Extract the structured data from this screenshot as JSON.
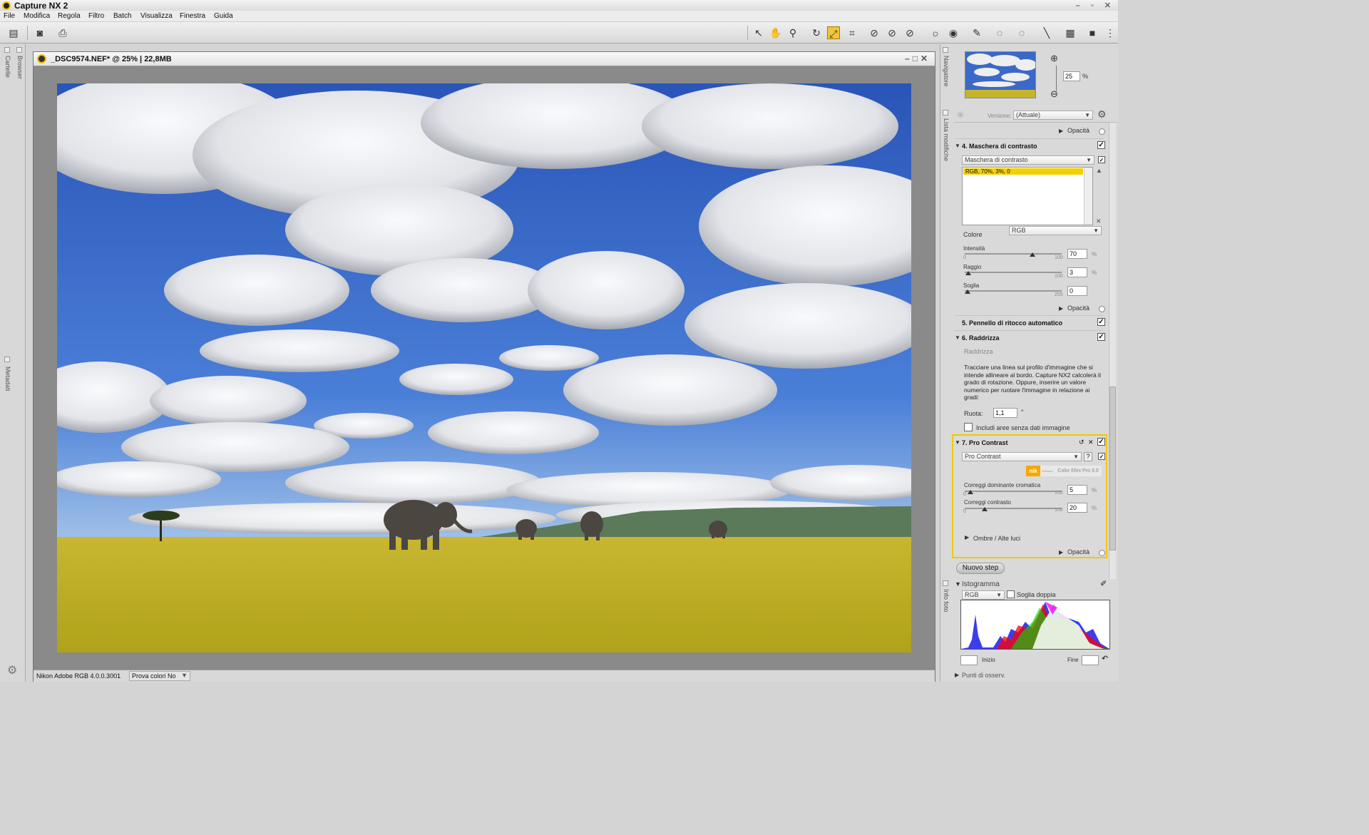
{
  "app": {
    "title": "Capture NX 2"
  },
  "menu": [
    "File",
    "Modifica",
    "Regola",
    "Filtro",
    "Batch",
    "Visualizza",
    "Finestra",
    "Guida"
  ],
  "document": {
    "title": "_DSC9574.NEF* @ 25% | 22,8MB",
    "profile": "Nikon Adobe RGB 4.0.0.3001",
    "soft_proof": "Prova colori No"
  },
  "left_tabs": {
    "cartelle": "Cartelle",
    "browser": "Browser",
    "metadati": "Metadati"
  },
  "navigator": {
    "tab": "Navigatore",
    "zoom_value": "25",
    "zoom_unit": "%"
  },
  "edit_list": {
    "tab": "Lista modifiche",
    "version_label": "Versione:",
    "version_value": "(Attuale)",
    "opacity_label": "Opacità",
    "step4": {
      "title": "4. Maschera di contrasto",
      "dropdown": "Maschera di contrasto",
      "list_item": "RGB, 70%, 3%, 0",
      "color_label": "Colore",
      "color_value": "RGB",
      "intensity_label": "Intensità",
      "intensity_value": "70",
      "intensity_max": "100",
      "radius_label": "Raggio",
      "radius_value": "3",
      "radius_max": "100",
      "threshold_label": "Soglia",
      "threshold_value": "0",
      "threshold_max": "255",
      "slider_min": "0",
      "pct": "%"
    },
    "step5": {
      "title": "5. Pennello di ritocco automatico"
    },
    "step6": {
      "title": "6. Raddrizza",
      "subtitle": "Raddrizza",
      "desc": "Tracciare una linea sul profilo d'immagine che si intende allineare al bordo. Capture NX2 calcolerà il grado di rotazione. Oppure, inserire un valore numerico per ruotare l'immagine in relazione ai gradi:",
      "rotate_label": "Ruota:",
      "rotate_value": "1,1",
      "degree": "°",
      "include_label": "Includi aree senza dati immagine"
    },
    "step7": {
      "title": "7. Pro Contrast",
      "dropdown": "Pro Contrast",
      "help": "?",
      "brand_nik": "nik",
      "brand_software": "Software",
      "brand_product": "Color Efex Pro 3.0",
      "cast_label": "Correggi dominante cromatica",
      "cast_value": "5",
      "contrast_label": "Correggi contrasto",
      "contrast_value": "20",
      "slider_min": "0",
      "slider_max": "100",
      "pct": "%",
      "shadows_label": "Ombre / Alte luci"
    },
    "new_step": "Nuovo step"
  },
  "histogram": {
    "tab": "Info foto",
    "title": "Istogramma",
    "channel": "RGB",
    "double_threshold": "Soglia doppia",
    "start_label": "Inizio",
    "end_label": "Fine"
  },
  "watch_points": "Punti di osserv."
}
